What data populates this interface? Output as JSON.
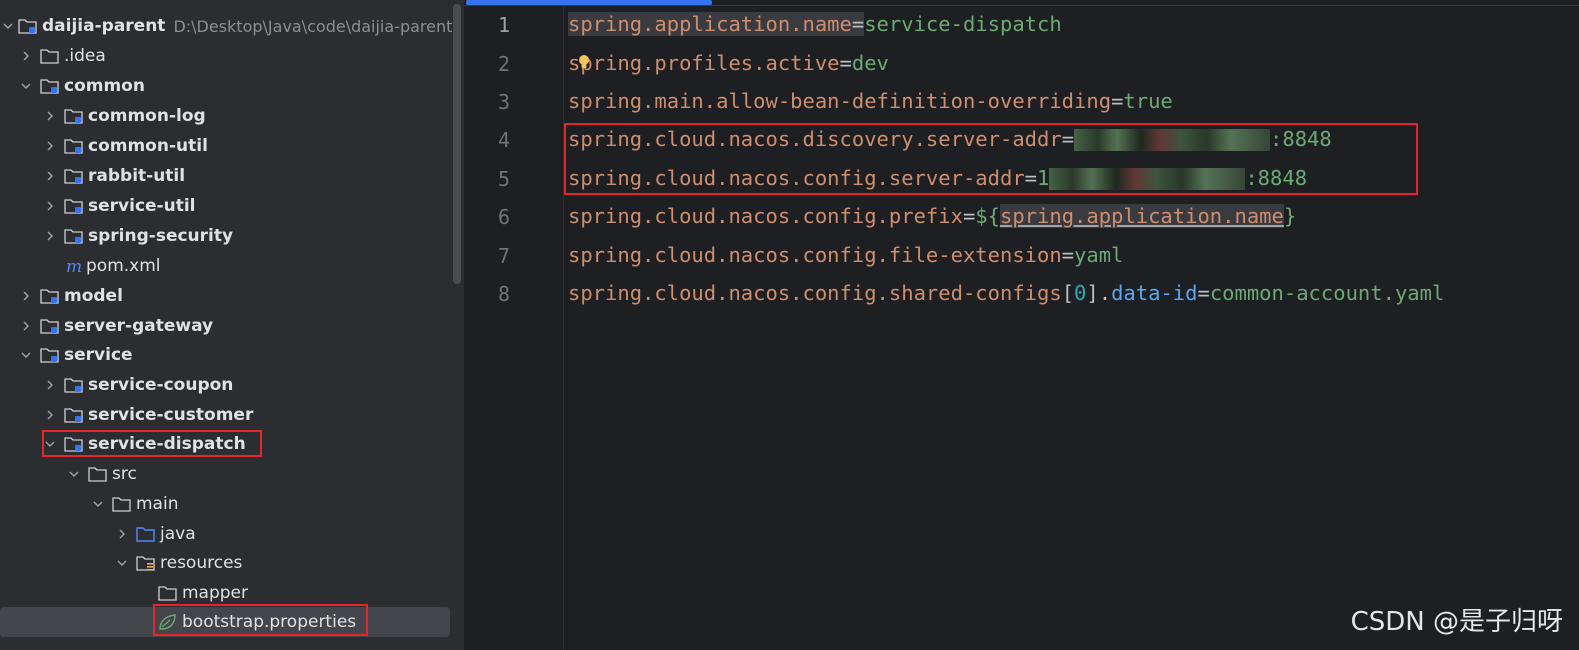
{
  "project_tree": {
    "root": {
      "label": "daijia-parent",
      "path": "D:\\Desktop\\Java\\code\\daijia-parent"
    },
    "items": [
      {
        "label": ".idea",
        "type": "folder",
        "expanded": false
      },
      {
        "label": "common",
        "type": "module",
        "expanded": true
      },
      {
        "label": "common-log",
        "type": "module",
        "expanded": false
      },
      {
        "label": "common-util",
        "type": "module",
        "expanded": false
      },
      {
        "label": "rabbit-util",
        "type": "module",
        "expanded": false
      },
      {
        "label": "service-util",
        "type": "module",
        "expanded": false
      },
      {
        "label": "spring-security",
        "type": "module",
        "expanded": false
      },
      {
        "label": "pom.xml",
        "type": "maven-file"
      },
      {
        "label": "model",
        "type": "module",
        "expanded": false
      },
      {
        "label": "server-gateway",
        "type": "module",
        "expanded": false
      },
      {
        "label": "service",
        "type": "module",
        "expanded": true
      },
      {
        "label": "service-coupon",
        "type": "module",
        "expanded": false
      },
      {
        "label": "service-customer",
        "type": "module",
        "expanded": false
      },
      {
        "label": "service-dispatch",
        "type": "module",
        "expanded": true
      },
      {
        "label": "src",
        "type": "folder",
        "expanded": true
      },
      {
        "label": "main",
        "type": "folder",
        "expanded": true
      },
      {
        "label": "java",
        "type": "source-folder",
        "expanded": false
      },
      {
        "label": "resources",
        "type": "resources-folder",
        "expanded": true
      },
      {
        "label": "mapper",
        "type": "folder"
      },
      {
        "label": "bootstrap.properties",
        "type": "properties-file",
        "selected": true
      }
    ]
  },
  "editor": {
    "line_numbers": [
      "1",
      "2",
      "3",
      "4",
      "5",
      "6",
      "7",
      "8"
    ],
    "lines": {
      "l1": {
        "key": "spring.application.name",
        "eq": "=",
        "value": "service-dispatch"
      },
      "l2": {
        "key": "spring.profiles.active",
        "eq": "=",
        "value": "dev"
      },
      "l3": {
        "key": "spring.main.allow-bean-definition-overriding",
        "eq": "=",
        "value": "true"
      },
      "l4": {
        "key": "spring.cloud.nacos.discovery.server-addr",
        "eq": "=",
        "value_visible": ":8848"
      },
      "l5": {
        "key": "spring.cloud.nacos.config.server-addr",
        "eq": "=",
        "value_prefix": "1",
        "value_visible": ":8848"
      },
      "l6": {
        "key": "spring.cloud.nacos.config.prefix",
        "eq": "=",
        "open": "${",
        "ref": "spring.application.name",
        "close": "}"
      },
      "l7": {
        "key": "spring.cloud.nacos.config.file-extension",
        "eq": "=",
        "value": "yaml"
      },
      "l8": {
        "key": "spring.cloud.nacos.config.shared-configs",
        "lb": "[",
        "index": "0",
        "rb": "]",
        "dot": ".",
        "sub": "data-id",
        "eq": "=",
        "value": "common-account.yaml"
      }
    }
  },
  "watermark": "CSDN @是子归呀",
  "colors": {
    "key": "#cf8e6d",
    "value": "#6aab73",
    "number": "#2aacb8",
    "property": "#56a8f5",
    "highlight_box": "#e5262d",
    "selection": "#43454a",
    "tab_indicator": "#3574f0"
  }
}
